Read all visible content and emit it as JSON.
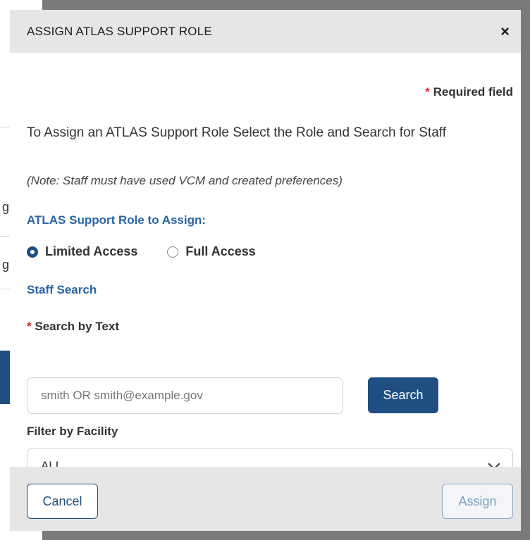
{
  "background": {
    "fragments": [
      "g",
      "g"
    ]
  },
  "dialog": {
    "title": "ASSIGN ATLAS SUPPORT ROLE",
    "close_symbol": "×",
    "required_asterisk": "*",
    "required_text": "Required field",
    "instructions": "To Assign an ATLAS Support Role Select the Role and Search for Staff",
    "note": "(Note: Staff must have used VCM and created preferences)",
    "role_section_label": "ATLAS Support Role to Assign:",
    "role_options": [
      {
        "label": "Limited Access",
        "selected": true
      },
      {
        "label": "Full Access",
        "selected": false
      }
    ],
    "staff_search_label": "Staff Search",
    "search_field": {
      "asterisk": "*",
      "label": "Search by Text",
      "placeholder": "smith OR smith@example.gov",
      "value": ""
    },
    "search_button": "Search",
    "facility_filter": {
      "label": "Filter by Facility",
      "selected": "ALL"
    },
    "footer": {
      "cancel": "Cancel",
      "assign": "Assign"
    }
  },
  "colors": {
    "primary": "#1f4f82",
    "section_label": "#2a64a3",
    "required": "#d0312d",
    "header_bg": "#e6e6e6"
  }
}
